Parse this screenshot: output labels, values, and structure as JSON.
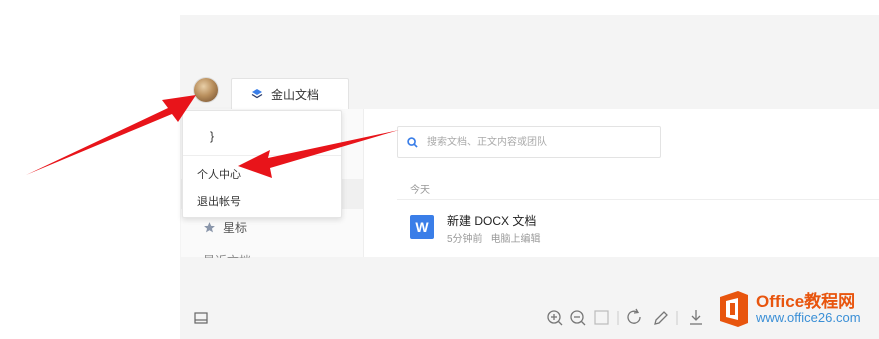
{
  "tab": {
    "label": "金山文档"
  },
  "dropdown": {
    "user_partial": "}",
    "items": [
      {
        "label": "个人中心"
      },
      {
        "label": "退出帐号"
      }
    ]
  },
  "sidebar": {
    "star_label": "星标",
    "recent_label_partial": "最近文档",
    "tail": "‹"
  },
  "search": {
    "placeholder": "搜索文档、正文内容或团队"
  },
  "list": {
    "group": "今天",
    "items": [
      {
        "title": "新建 DOCX 文档",
        "time": "5分钟前",
        "location": "电脑上编辑",
        "icon_letter": "W"
      }
    ]
  },
  "watermark": {
    "line1": "Office教程网",
    "line2": "www.office26.com"
  },
  "colors": {
    "accent": "#3a7ee8",
    "arrow": "#e8141a",
    "watermark_orange": "#e8550e"
  }
}
